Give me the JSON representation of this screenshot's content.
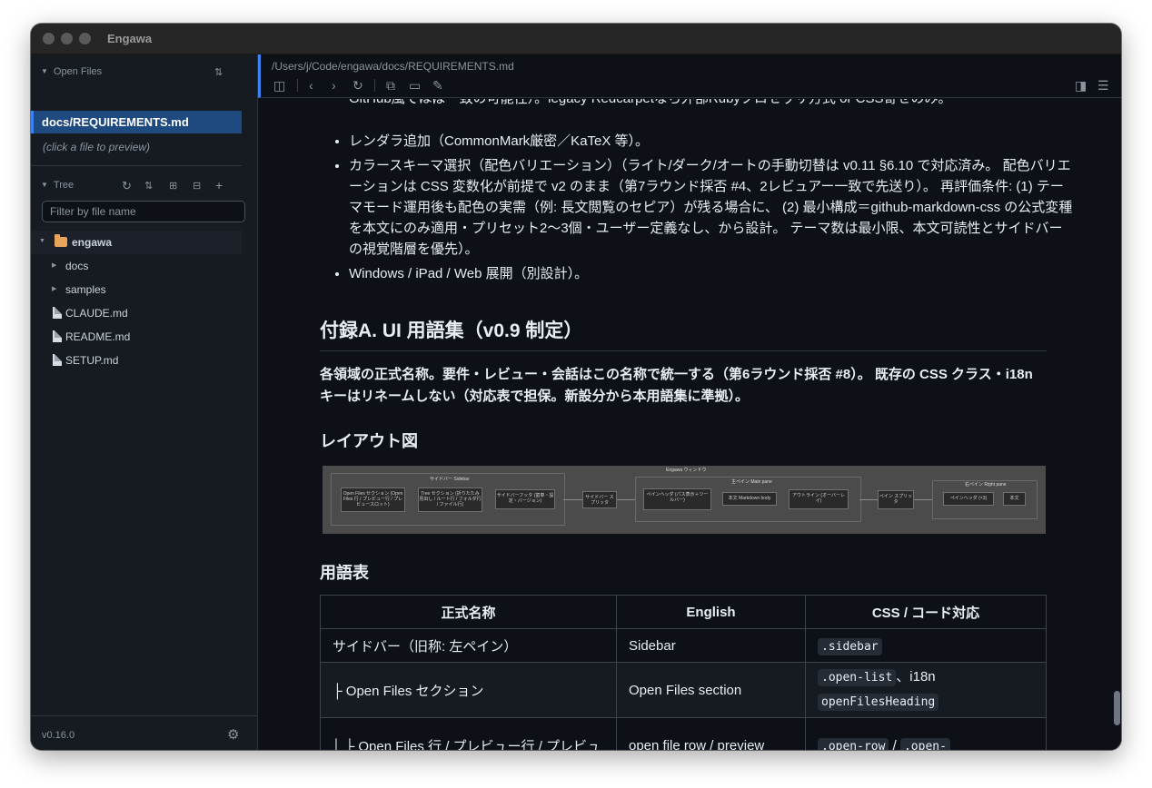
{
  "window": {
    "title": "Engawa"
  },
  "sidebar": {
    "open_files": {
      "heading": "Open Files",
      "items": [
        "docs/REQUIREMENTS.md"
      ],
      "hint": "(click a file to preview)"
    },
    "tree": {
      "heading": "Tree",
      "filter_placeholder": "Filter by file name",
      "root": "engawa",
      "items": [
        {
          "label": "docs",
          "kind": "folder"
        },
        {
          "label": "samples",
          "kind": "folder"
        },
        {
          "label": "CLAUDE.md",
          "kind": "file"
        },
        {
          "label": "README.md",
          "kind": "file"
        },
        {
          "label": "SETUP.md",
          "kind": "file"
        }
      ]
    },
    "version": "v0.16.0"
  },
  "main": {
    "path": "/Users/j/Code/engawa/docs/REQUIREMENTS.md",
    "content": {
      "partial_top_line": "GitHub風でほぼ一致の可能性）。legacy Redcarpetなら外部Rubyプロセッサ方式 or CSS寄せのみ。",
      "bullets": [
        "レンダラ追加（CommonMark厳密／KaTeX 等）。",
        "カラースキーマ選択（配色バリエーション）（ライト/ダーク/オートの手動切替は v0.11 §6.10 で対応済み。 配色バリエーションは CSS 変数化が前提で v2 のまま（第7ラウンド採否 #4、2レビュアー一致で先送り）。 再評価条件: (1) テーマモード運用後も配色の実需（例: 長文閲覧のセピア）が残る場合に、 (2) 最小構成＝github-markdown-css の公式変種を本文にのみ適用・プリセット2〜3個・ユーザー定義なし、から設計。 テーマ数は最小限、本文可読性とサイドバーの視覚階層を優先）。",
        "Windows / iPad / Web 展開（別設計）。"
      ],
      "appendix_heading": "付録A. UI 用語集（v0.9 制定）",
      "appendix_para": "各領域の正式名称。要件・レビュー・会話はこの名称で統一する（第6ラウンド採否 #8）。 既存の CSS クラス・i18n キーはリネームしない（対応表で担保。新設分から本用語集に準拠）。",
      "layout_heading": "レイアウト図",
      "diagram": {
        "title": "Engawa ウィンドウ",
        "sidebar_label": "サイドバー Sidebar",
        "sidebar_boxes": [
          "Open Files セクション (Open Files 行 / プレビュー行 / プレビュースロット)",
          "Tree セクション (折りたたみ見出し / ルート行 / フォルダ行 / ファイル行)",
          "サイドバーフッタ (歯車・設定・バージョン)"
        ],
        "splitter1": "サイドバー スプリッタ",
        "main_label": "主ペイン Main pane",
        "main_boxes": [
          "ペインヘッダ (パス表示＋ツールバー)",
          "本文 Markdown body",
          "アウトライン (オーバーレイ)"
        ],
        "splitter2": "ペイン スプリッタ",
        "right_label": "右ペイン Right pane",
        "right_boxes": [
          "ペインヘッダ (×3)",
          "本文"
        ]
      },
      "terms_heading": "用語表",
      "table": {
        "headers": [
          "正式名称",
          "English",
          "CSS / コード対応"
        ],
        "rows": [
          {
            "name": "サイドバー（旧称: 左ペイン）",
            "english": "Sidebar",
            "code": [
              ".sidebar"
            ],
            "tail": ""
          },
          {
            "name": "├ Open Files セクション",
            "english": "Open Files section",
            "code": [
              ".open-list",
              "openFilesHeading"
            ],
            "sep": "、i18n",
            "tail": ""
          },
          {
            "name": "│ ├ Open Files 行 / プレビュー行 / プレビュ",
            "english": "open file row / preview",
            "code": [
              ".open-row",
              ".open-"
            ],
            "sep": " / ",
            "tail": ""
          }
        ]
      }
    }
  }
}
